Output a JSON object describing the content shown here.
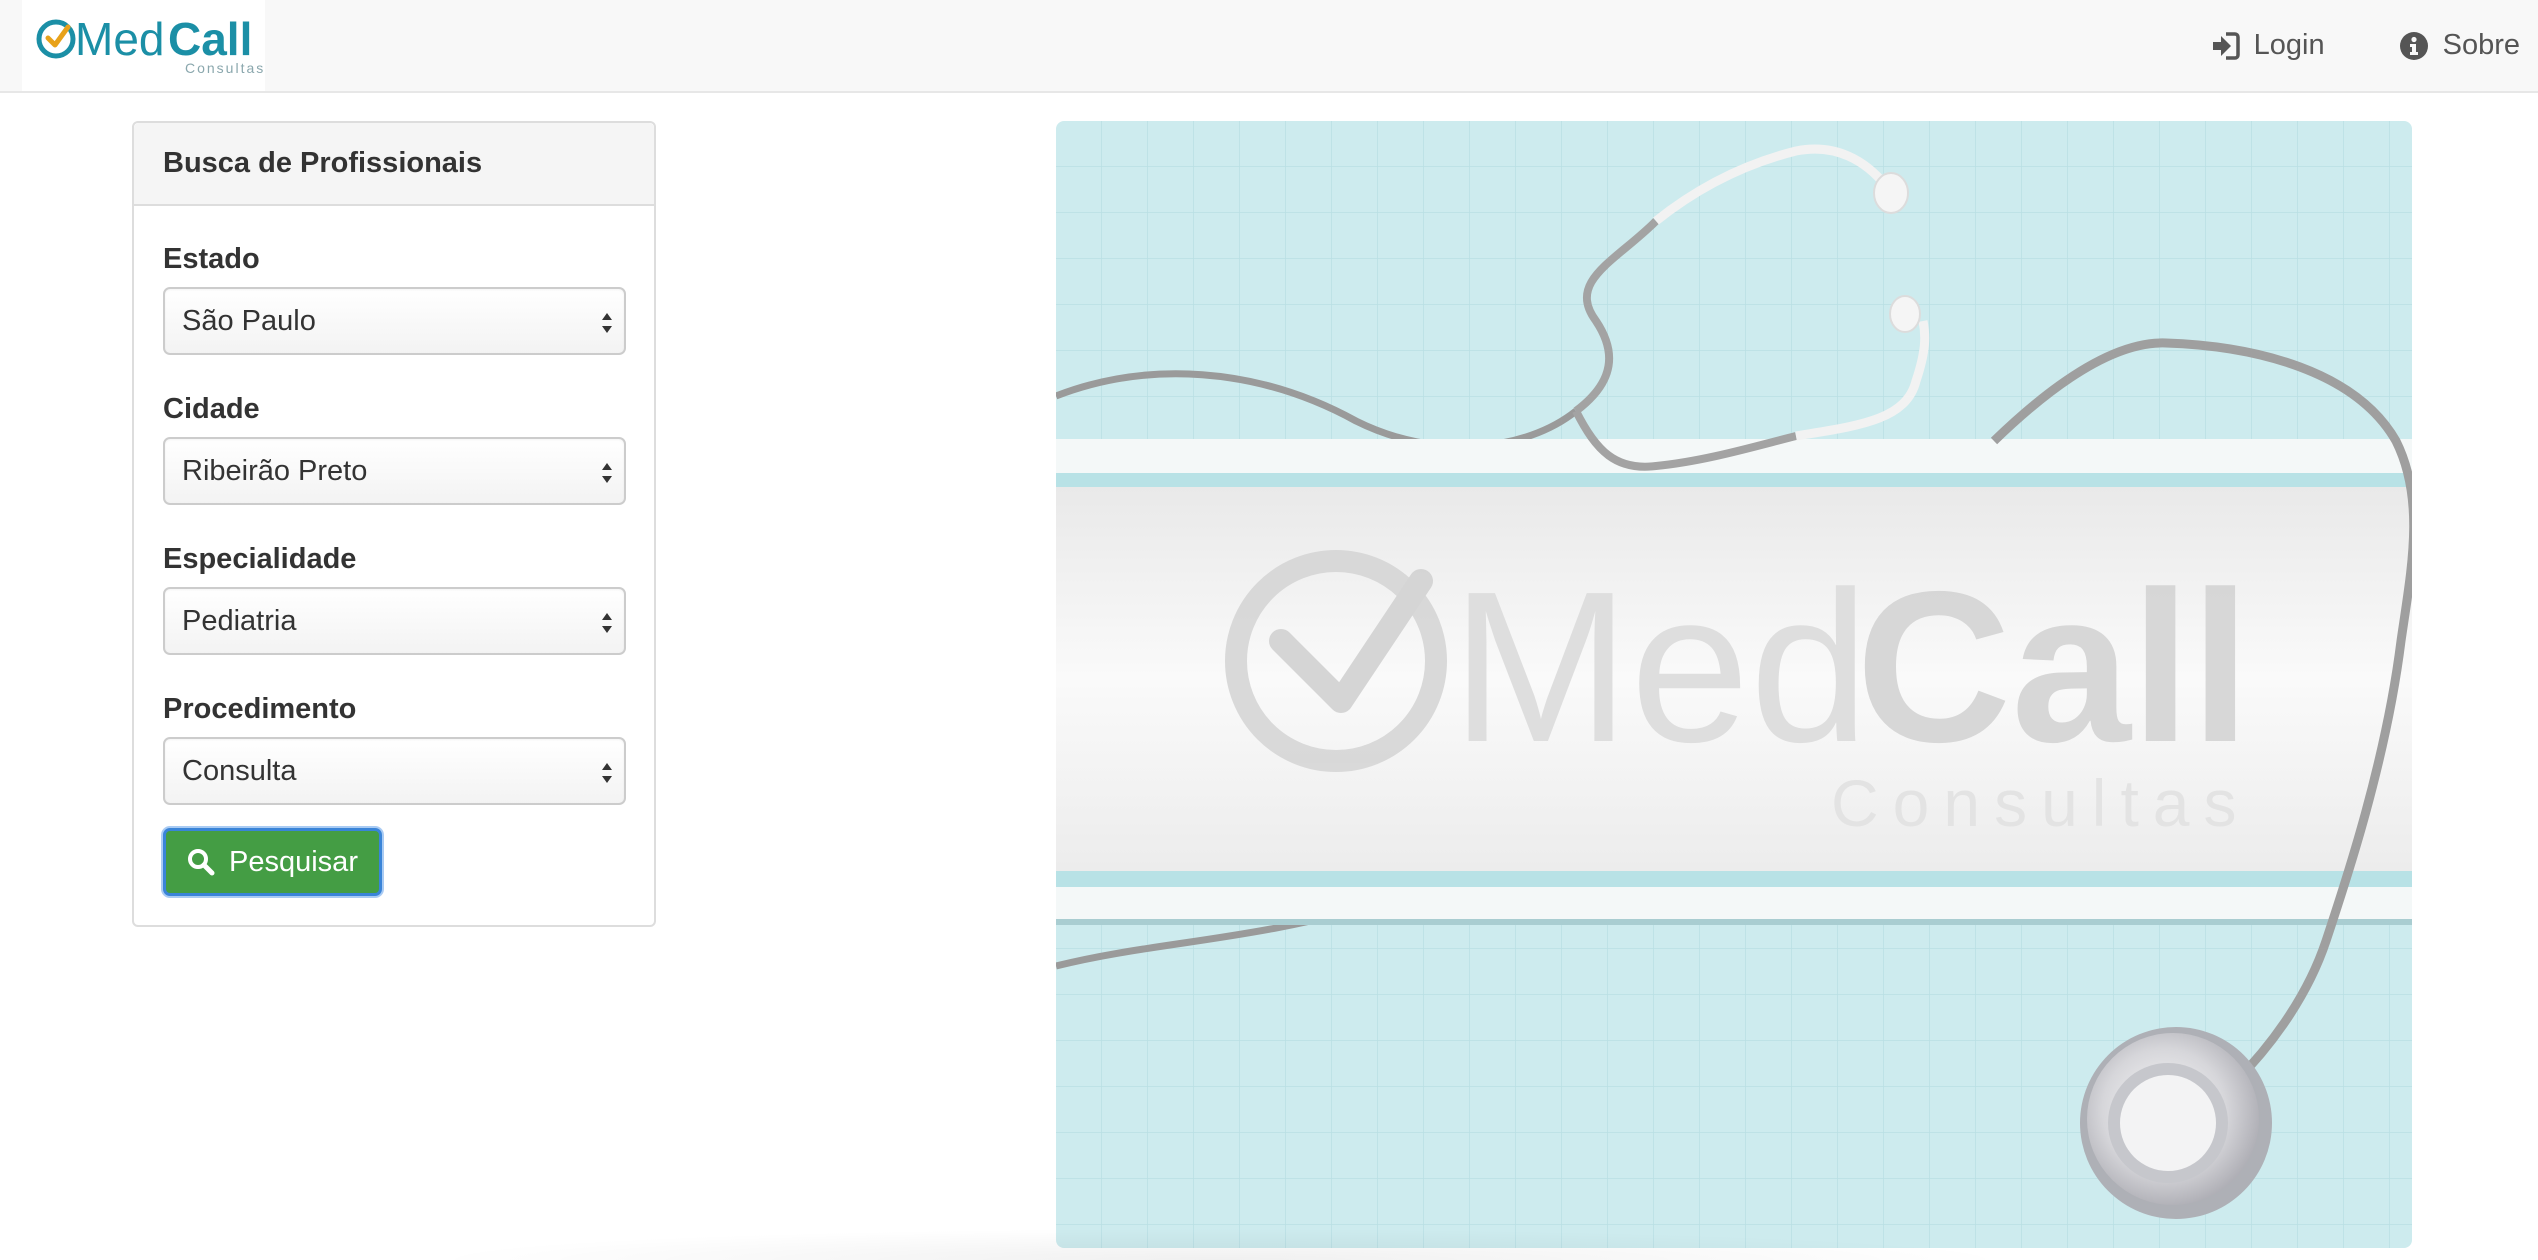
{
  "brand": {
    "name_part1": "Med",
    "name_part2": "Call",
    "tagline": "Consultas"
  },
  "nav": {
    "login_label": "Login",
    "about_label": "Sobre"
  },
  "search_panel": {
    "title": "Busca de Profissionais",
    "fields": [
      {
        "label": "Estado",
        "value": "São Paulo"
      },
      {
        "label": "Cidade",
        "value": "Ribeirão Preto"
      },
      {
        "label": "Especialidade",
        "value": "Pediatria"
      },
      {
        "label": "Procedimento",
        "value": "Consulta"
      }
    ],
    "search_button_label": "Pesquisar"
  },
  "hero": {
    "watermark_part1": "Med",
    "watermark_part2": "Call",
    "watermark_tagline": "Consultas"
  },
  "colors": {
    "brand_teal": "#1b8fa6",
    "brand_check": "#e8a21a",
    "button_green": "#449d44",
    "hero_bg": "#cdebee"
  },
  "icons": {
    "login": "sign-in-icon",
    "about": "info-circle-icon",
    "search": "search-icon",
    "select_arrows": "select-arrows-icon"
  }
}
